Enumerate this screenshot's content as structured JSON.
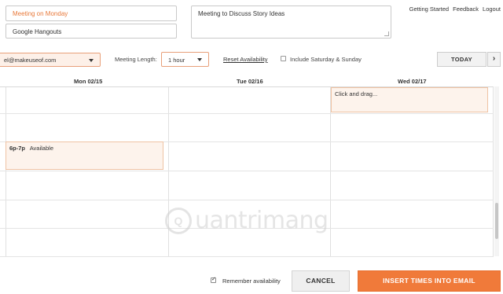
{
  "form": {
    "title_value": "Meeting on Monday",
    "location_value": "Google Hangouts",
    "description_value": "Meeting to Discuss Story Ideas"
  },
  "top_links": {
    "getting_started": "Getting Started",
    "feedback": "Feedback",
    "logout": "Logout"
  },
  "toolbar": {
    "email_value": "el@makeuseof.com",
    "meeting_length_label": "Meeting Length:",
    "meeting_length_value": "1 hour",
    "reset_label": "Reset Availability",
    "weekend_label": "Include Saturday & Sunday",
    "weekend_checked": false,
    "today_label": "TODAY",
    "next_label": "›"
  },
  "calendar": {
    "days": [
      "Mon 02/15",
      "Tue 02/16",
      "Wed 02/17"
    ],
    "draft_event_text": "Click and drag...",
    "availability_event": {
      "time": "6p-7p",
      "label": "Available"
    }
  },
  "watermark": {
    "text": "uantrimang",
    "logo_letter": "Q"
  },
  "footer": {
    "remember_label": "Remember availability",
    "remember_checked": true,
    "cancel_label": "CANCEL",
    "insert_label": "INSERT TIMES INTO EMAIL"
  },
  "colors": {
    "accent": "#f07a3a",
    "event_fill": "#fdf3ec",
    "event_border": "#efc3a4"
  }
}
